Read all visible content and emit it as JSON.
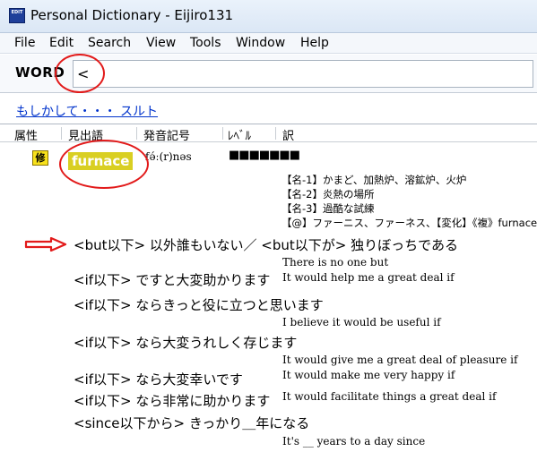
{
  "window": {
    "title": "Personal Dictionary - Eijiro131",
    "app_icon_text": "EDIT"
  },
  "menu": [
    "File",
    "Edit",
    "Search",
    "View",
    "Tools",
    "Window",
    "Help"
  ],
  "search": {
    "label": "WORD",
    "value": "<"
  },
  "suggestion": {
    "text": "もしかして・・・ スルト"
  },
  "columns": [
    "属性",
    "見出語",
    "発音記号",
    "ﾚﾍﾞﾙ",
    "訳"
  ],
  "entry": {
    "attribute": "修",
    "headword": "furnace",
    "pronunciation": "fə́ː(r)nəs",
    "level": "■■■■■■■",
    "definitions": [
      "【名-1】かまど、加熱炉、溶鉱炉、火炉",
      "【名-2】炎熱の場所",
      "【名-3】過酷な試練",
      "【@】ファーニス、ファーネス、【変化】《複》furnaces"
    ]
  },
  "examples": [
    {
      "jp": "<but以下> 以外誰もいない／ <but以下が> 独りぼっちである",
      "en": "There is no one but"
    },
    {
      "jp": "<if以下> ですと大変助かります",
      "en": "It would help me a great deal if"
    },
    {
      "jp": "<if以下> ならきっと役に立つと思います",
      "en": "I believe it would be useful if"
    },
    {
      "jp": "<if以下> なら大変うれしく存じます",
      "en": "It would give me a great deal of pleasure if"
    },
    {
      "jp": "<if以下> なら大変幸いです",
      "en": "It would make me very happy if"
    },
    {
      "jp": "<if以下> なら非常に助かります",
      "en": "It would facilitate things a great deal if"
    },
    {
      "jp": "<since以下から> きっかり＿年になる",
      "en": "It's __ years to a day since"
    }
  ],
  "colors": {
    "annotation": "#e21a1a",
    "headword_bg": "#d9cf22",
    "badge_bg": "#f7e11c",
    "link": "#0033cc"
  }
}
